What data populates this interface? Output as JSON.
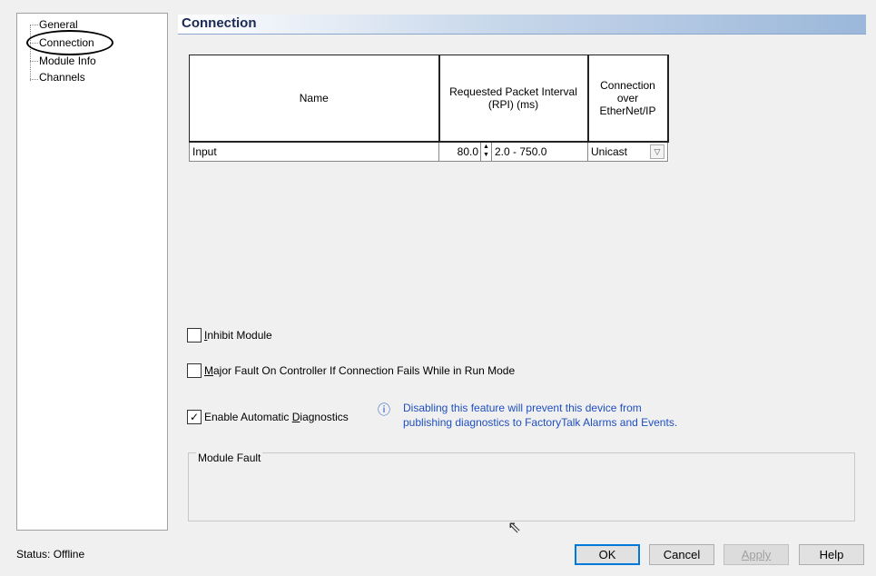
{
  "tree": {
    "items": [
      {
        "label": "General"
      },
      {
        "label": "Connection"
      },
      {
        "label": "Module Info"
      },
      {
        "label": "Channels"
      }
    ]
  },
  "section": {
    "title": "Connection"
  },
  "table": {
    "headers": {
      "name": "Name",
      "rpi": "Requested Packet Interval (RPI) (ms)",
      "connection": "Connection over EtherNet/IP"
    },
    "rows": [
      {
        "name": "Input",
        "rpi_value": "80.0",
        "rpi_range": "2.0 - 750.0",
        "connection": "Unicast"
      }
    ]
  },
  "options": {
    "inhibit": {
      "prefix": "",
      "mnemonic": "I",
      "rest": "nhibit Module",
      "checked": false
    },
    "major_fault": {
      "prefix": "",
      "mnemonic": "M",
      "rest": "ajor Fault On Controller If Connection Fails While in Run Mode",
      "checked": false
    },
    "auto_diag": {
      "prefix": "Enable Automatic ",
      "mnemonic": "D",
      "rest": "iagnostics",
      "checked": true
    }
  },
  "info": {
    "line1": "Disabling this feature will prevent this device from",
    "line2": "publishing diagnostics to FactoryTalk Alarms and Events."
  },
  "fault": {
    "label": "Module Fault"
  },
  "status": {
    "text": "Status:  Offline"
  },
  "buttons": {
    "ok": "OK",
    "cancel": "Cancel",
    "apply": "Apply",
    "help": "Help"
  },
  "icons": {
    "info": "info-icon",
    "checkmark": "checkmark-icon",
    "spin": "spin-arrows-icon",
    "dropdown": "chevron-down-icon",
    "cursor": "mouse-cursor-icon"
  },
  "colors": {
    "header_text": "#1a2a55",
    "info_text": "#1f4fbf",
    "default_button_border": "#0078d7"
  }
}
